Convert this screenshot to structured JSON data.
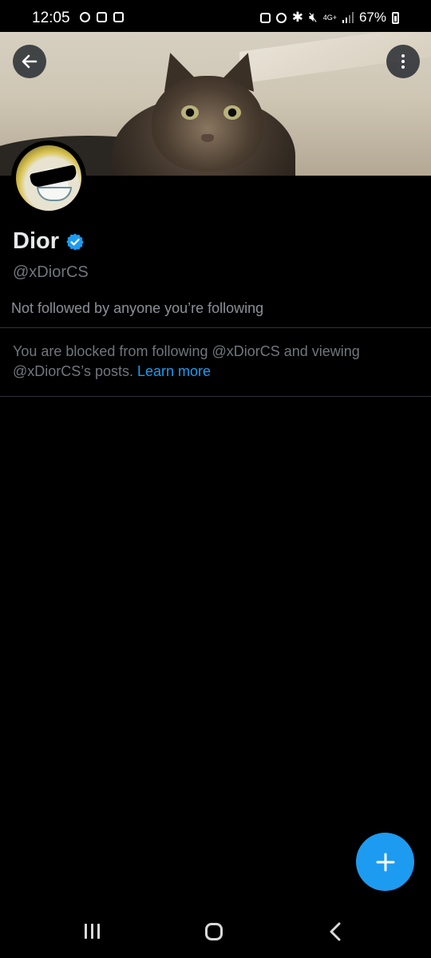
{
  "status_bar": {
    "time": "12:05",
    "battery": "67%",
    "network": "4G+",
    "icons": [
      "bulb-icon",
      "phone-icon",
      "record-icon",
      "lock-icon",
      "alarm-icon",
      "bluetooth-icon",
      "mute-icon",
      "signal-icon",
      "battery-icon"
    ]
  },
  "header": {
    "back_icon": "arrow-left-icon",
    "more_icon": "more-vertical-icon"
  },
  "profile": {
    "name": "Dior",
    "verified": true,
    "handle": "@xDiorCS",
    "followed_by": "Not followed by anyone you’re following",
    "blocked_text": "You are blocked from following @xDiorCS and viewing @xDiorCS’s posts.",
    "learn_more": "Learn more"
  },
  "colors": {
    "accent": "#1d9bf0",
    "background": "#000000",
    "muted_text": "#71767b",
    "divider": "#2f3336"
  },
  "fab": {
    "icon": "plus-icon"
  },
  "nav_bar": {
    "recent_icon": "recents-icon",
    "home_icon": "home-icon",
    "back_icon": "back-chevron-icon"
  }
}
